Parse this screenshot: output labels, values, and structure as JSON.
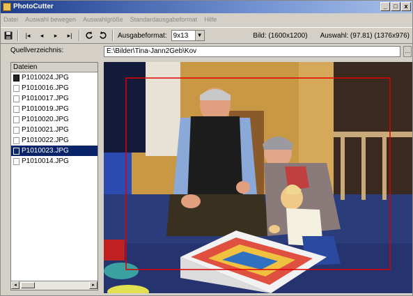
{
  "window": {
    "title": "PhotoCutter",
    "buttons": [
      "_",
      "□",
      "x"
    ]
  },
  "menu": [
    "Datei",
    "Auswahl bewegen",
    "Auswahlgröße",
    "Standardausgabeformat",
    "Hilfe"
  ],
  "toolbar": {
    "format_label": "Ausgabeformat:",
    "format_value": "9x13",
    "image_info": "Bild: (1600x1200)",
    "selection_info": "Auswahl: (97.81) (1376x976)"
  },
  "source": {
    "label": "Quellverzeichnis:",
    "path": "E:\\Bilder\\Tina-Jann2Geb\\Kov"
  },
  "files": {
    "header": "Dateien",
    "items": [
      {
        "name": "P1010024.JPG"
      },
      {
        "name": "P1010016.JPG"
      },
      {
        "name": "P1010017.JPG"
      },
      {
        "name": "P1010019.JPG"
      },
      {
        "name": "P1010020.JPG"
      },
      {
        "name": "P1010021.JPG"
      },
      {
        "name": "P1010022.JPG"
      },
      {
        "name": "P1010023.JPG"
      },
      {
        "name": "P1010014.JPG"
      }
    ],
    "selected_index": 7
  },
  "colors": {
    "selection_rect": "#e00000",
    "list_selected": "#0a246a"
  }
}
